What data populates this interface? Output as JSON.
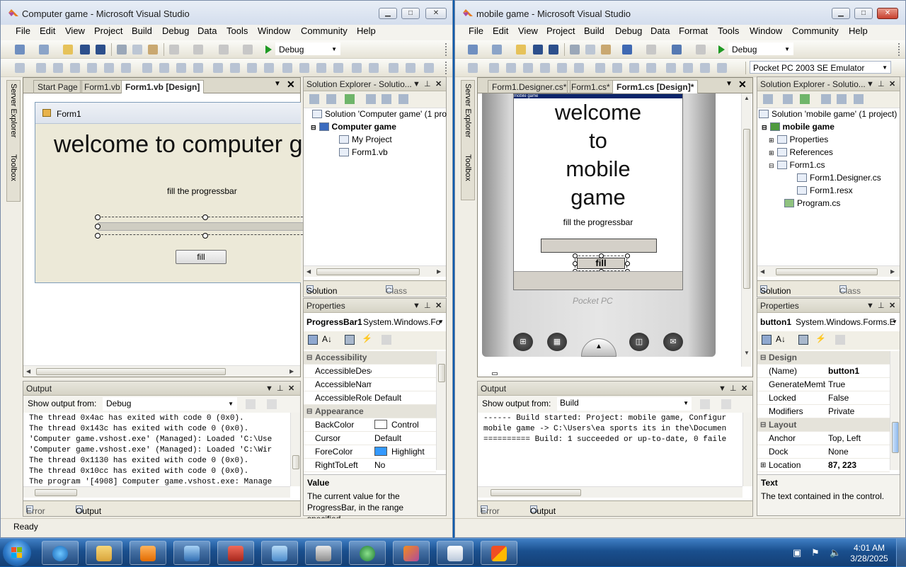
{
  "left": {
    "title": "Computer game - Microsoft Visual Studio",
    "menu": [
      "File",
      "Edit",
      "View",
      "Project",
      "Build",
      "Debug",
      "Data",
      "Tools",
      "Window",
      "Community",
      "Help"
    ],
    "config": "Debug",
    "side_tabs": [
      "Server Explorer",
      "Toolbox"
    ],
    "doc_tabs": [
      "Start Page",
      "Form1.vb",
      "Form1.vb [Design]"
    ],
    "form": {
      "caption": "Form1",
      "heading": "welcome to computer g",
      "label": "fill the progressbar",
      "button": "fill"
    },
    "solution": {
      "header": "Solution Explorer - Solutio...",
      "items": [
        "Solution 'Computer game' (1 pro",
        "Computer game",
        "My Project",
        "Form1.vb"
      ],
      "tabs": [
        "Solution Explorer",
        "Class View"
      ]
    },
    "properties": {
      "header": "Properties",
      "object": "ProgressBar1",
      "type": "System.Windows.Fo",
      "rows": [
        {
          "k": "Accessibility",
          "v": "",
          "cat": true
        },
        {
          "k": "AccessibleDesc",
          "v": ""
        },
        {
          "k": "AccessibleNam",
          "v": ""
        },
        {
          "k": "AccessibleRole",
          "v": "Default"
        },
        {
          "k": "Appearance",
          "v": "",
          "cat": true
        },
        {
          "k": "BackColor",
          "v": "Control",
          "color": "#ffffff"
        },
        {
          "k": "Cursor",
          "v": "Default"
        },
        {
          "k": "ForeColor",
          "v": "Highlight",
          "color": "#3399ff"
        },
        {
          "k": "RightToLeft",
          "v": "No"
        }
      ],
      "desc_title": "Value",
      "desc": "The current value for the ProgressBar, in the range specified..."
    },
    "output": {
      "header": "Output",
      "from_label": "Show output from:",
      "from": "Debug",
      "lines": [
        "The thread 0x4ac has exited with code 0 (0x0).",
        "The thread 0x143c has exited with code 0 (0x0).",
        "'Computer game.vshost.exe' (Managed): Loaded 'C:\\Use",
        "'Computer game.vshost.exe' (Managed): Loaded 'C:\\Wir",
        "The thread 0x1130 has exited with code 0 (0x0).",
        "The thread 0x10cc has exited with code 0 (0x0).",
        "The program '[4908] Computer game.vshost.exe: Manage"
      ],
      "tabs": [
        "Error List",
        "Output"
      ]
    },
    "status": "Ready"
  },
  "right": {
    "title": "mobile game - Microsoft Visual Studio",
    "menu": [
      "File",
      "Edit",
      "View",
      "Project",
      "Build",
      "Debug",
      "Data",
      "Format",
      "Tools",
      "Window",
      "Community",
      "Help"
    ],
    "config": "Debug",
    "device": "Pocket PC 2003 SE Emulator",
    "side_tabs": [
      "Server Explorer",
      "Toolbox"
    ],
    "doc_tabs": [
      "Form1.Designer.cs*",
      "Form1.cs*",
      "Form1.cs [Design]*"
    ],
    "form": {
      "caption": "mobile game",
      "heading": [
        "welcome",
        "to",
        "mobile",
        "game"
      ],
      "label": "fill the progressbar",
      "button": "fill",
      "brand": "Pocket PC"
    },
    "solution": {
      "header": "Solution Explorer - Solutio...",
      "items": [
        "Solution 'mobile game' (1 project)",
        "mobile game",
        "Properties",
        "References",
        "Form1.cs",
        "Form1.Designer.cs",
        "Form1.resx",
        "Program.cs"
      ],
      "tabs": [
        "Solution Explorer",
        "Class View"
      ]
    },
    "properties": {
      "header": "Properties",
      "object": "button1",
      "type": "System.Windows.Forms.E",
      "rows": [
        {
          "k": "Design",
          "v": "",
          "cat": true
        },
        {
          "k": "(Name)",
          "v": "button1",
          "bold": true
        },
        {
          "k": "GenerateMemb",
          "v": "True"
        },
        {
          "k": "Locked",
          "v": "False"
        },
        {
          "k": "Modifiers",
          "v": "Private"
        },
        {
          "k": "Layout",
          "v": "",
          "cat": true
        },
        {
          "k": "Anchor",
          "v": "Top, Left"
        },
        {
          "k": "Dock",
          "v": "None"
        },
        {
          "k": "Location",
          "v": "87, 223",
          "bold": true
        }
      ],
      "desc_title": "Text",
      "desc": "The text contained in the control."
    },
    "output": {
      "header": "Output",
      "from_label": "Show output from:",
      "from": "Build",
      "lines": [
        "------ Build started: Project: mobile game, Configur",
        "mobile game -> C:\\Users\\ea sports its in the\\Documen",
        "========== Build: 1 succeeded or up-to-date, 0 faile"
      ],
      "tabs": [
        "Error List",
        "Output"
      ]
    }
  },
  "tray": {
    "time": "4:01 AM",
    "date": "3/28/2025"
  },
  "colors": {
    "taskbar": "#1a4f8e",
    "highlight": "#3399ff",
    "accent": "#0a246a"
  }
}
